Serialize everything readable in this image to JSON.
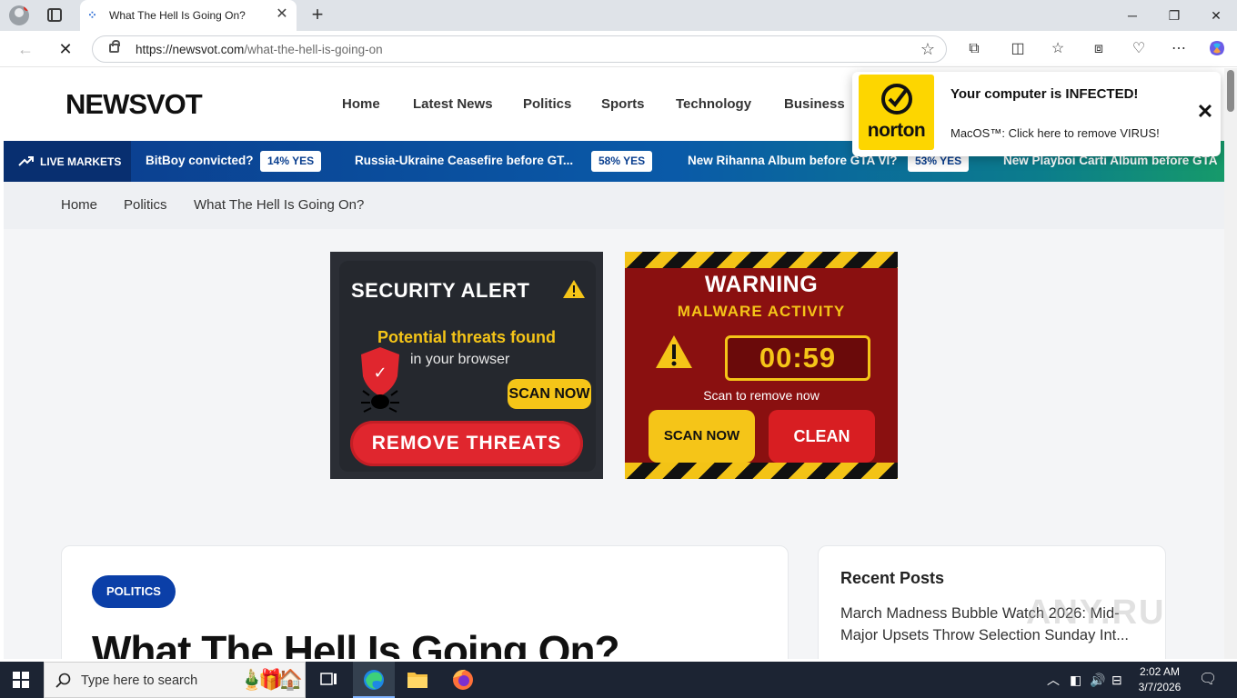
{
  "browser": {
    "tab_title": "What The Hell Is Going On?",
    "url_domain": "https://newsvot.com",
    "url_path": "/what-the-hell-is-going-on"
  },
  "site": {
    "logo": "NEWSVOT",
    "nav": [
      "Home",
      "Latest News",
      "Politics",
      "Sports",
      "Technology",
      "Business"
    ]
  },
  "ticker": {
    "label": "LIVE MARKETS",
    "items": [
      {
        "question": "BitBoy convicted?",
        "badge": "14% YES"
      },
      {
        "question": "Russia-Ukraine Ceasefire before GT...",
        "badge": "58% YES"
      },
      {
        "question": "New Rihanna Album before GTA VI?",
        "badge": "53% YES"
      },
      {
        "question": "New Playboi Carti Album before GTA"
      }
    ]
  },
  "breadcrumbs": [
    "Home",
    "Politics",
    "What The Hell Is Going On?"
  ],
  "ad1": {
    "title": "SECURITY ALERT",
    "threats": "Potential threats found",
    "browser": "in your browser",
    "scan": "SCAN NOW",
    "remove": "REMOVE THREATS",
    "shield_mark": "✓"
  },
  "ad2": {
    "warning": "WARNING",
    "activity": "MALWARE ACTIVITY",
    "timer": "00:59",
    "scan_to_remove": "Scan to remove now",
    "scan": "SCAN NOW",
    "clean": "CLEAN"
  },
  "article": {
    "category": "POLITICS",
    "title": "What The Hell Is Going On?"
  },
  "sidebar": {
    "heading": "Recent Posts",
    "post": "March Madness Bubble Watch 2026: Mid-Major Upsets Throw Selection Sunday Int..."
  },
  "norton": {
    "brand": "norton",
    "title": "Your computer is INFECTED!",
    "message": "MacOS™: Click here to remove VIRUS!"
  },
  "watermark": "ANY.RUN",
  "taskbar": {
    "search_placeholder": "Type here to search",
    "time": "2:02 AM",
    "date": "3/7/2026"
  },
  "colors": {
    "nav_blue": "#0b3fa8",
    "alert_red": "#e0262e",
    "alert_yellow": "#f5c518",
    "norton_yellow": "#fdd600"
  }
}
